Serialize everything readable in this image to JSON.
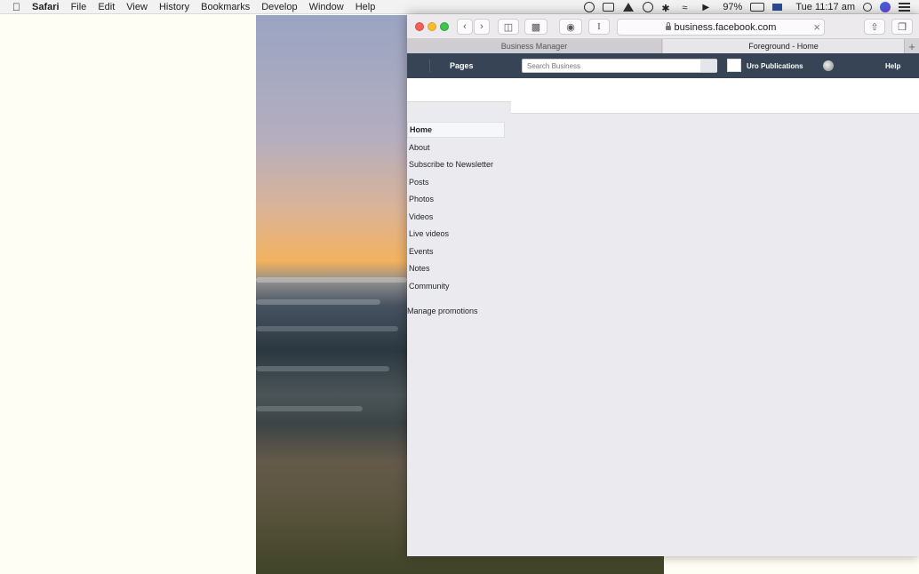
{
  "menubar": {
    "apple": "",
    "app_name": "Safari",
    "menus": [
      "File",
      "Edit",
      "View",
      "History",
      "Bookmarks",
      "Develop",
      "Window",
      "Help"
    ],
    "battery": "97%",
    "clock": "Tue 11:17 am"
  },
  "browser": {
    "address": "business.facebook.com",
    "tabs": [
      "Business Manager",
      "Foreground - Home"
    ],
    "new_tab": "+",
    "clear": "×"
  },
  "fb_header": {
    "pages_label": "Pages",
    "search_placeholder": "Search Business",
    "publication_name": "Uro Publications",
    "help_label": "Help"
  },
  "sidenav": {
    "items": [
      "Home",
      "About",
      "Subscribe to Newsletter",
      "Posts",
      "Photos",
      "Videos",
      "Live videos",
      "Events",
      "Notes",
      "Community"
    ],
    "manage_label": "Manage promotions"
  },
  "colors": {
    "fb_header_bg": "#364456",
    "window_bg": "#ebeaee",
    "desktop_bg": "#fffef5"
  }
}
